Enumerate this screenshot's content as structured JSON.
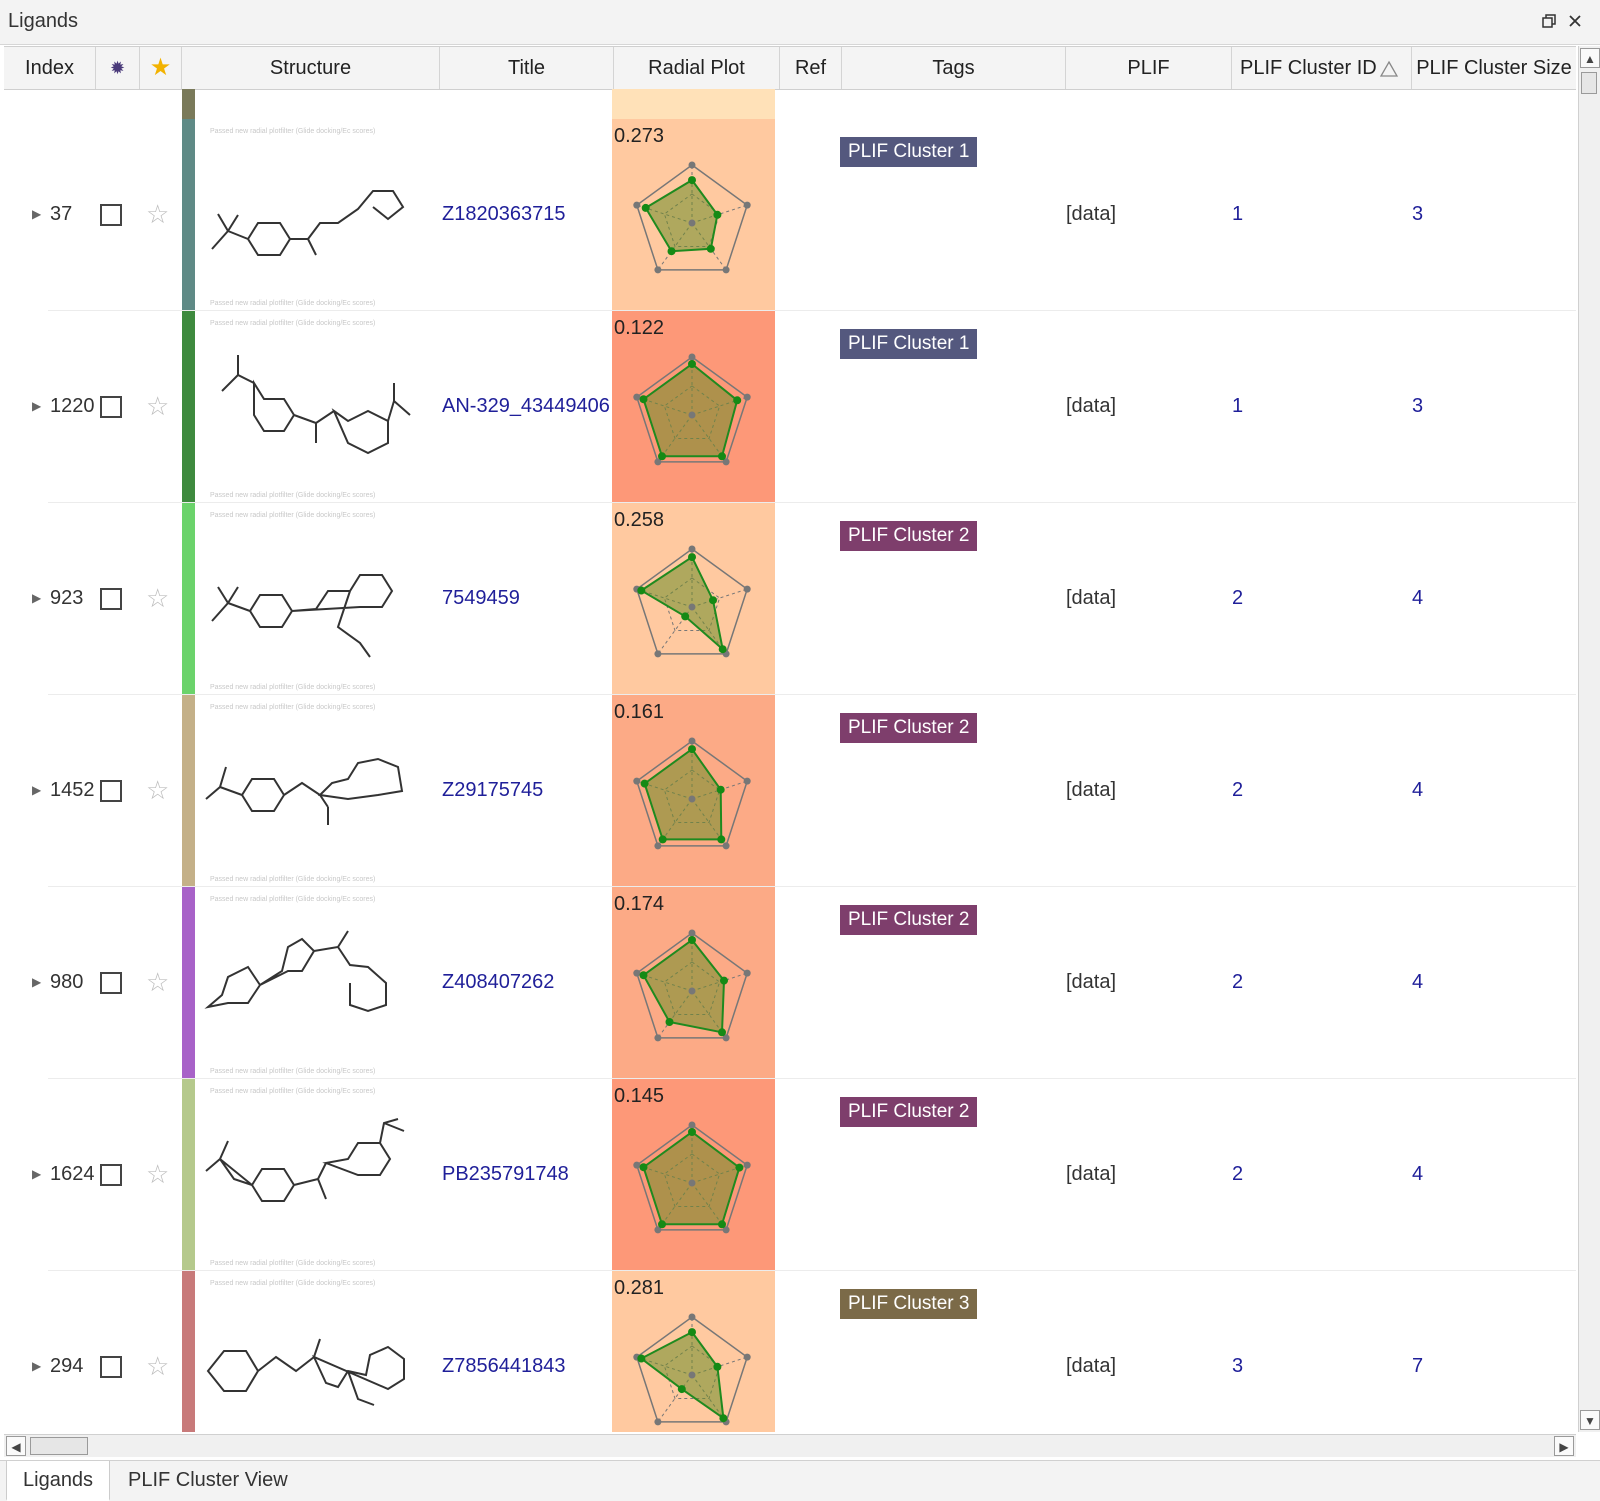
{
  "window": {
    "title": "Ligands",
    "restore_icon": "restore-icon",
    "close_icon": "close-icon"
  },
  "columns": {
    "index": "Index",
    "visibility_icon": "asterisk-icon",
    "favorite_icon": "star-icon",
    "structure": "Structure",
    "title": "Title",
    "radial_plot": "Radial Plot",
    "ref": "Ref",
    "tags": "Tags",
    "plif": "PLIF",
    "plif_cluster_id": "PLIF Cluster ID",
    "plif_cluster_size": "PLIF Cluster Size",
    "sort_indicator_icon": "sort-ascending-icon"
  },
  "structure_watermark": "Passed new radial plotfilter (Glide docking/Ec scores)",
  "rows": [
    {
      "index": "37",
      "title": "Z1820363715",
      "score": "0.273",
      "tag": "PLIF Cluster 1",
      "tag_color": "#54587e",
      "plif": "[data]",
      "cluster_id": "1",
      "cluster_size": "3",
      "bar_color": "#5f8a86",
      "radial_bg": "#ffc9a0",
      "radar": [
        0.74,
        0.46,
        0.55,
        0.6,
        0.84
      ]
    },
    {
      "index": "1220",
      "title": "AN-329_43449406",
      "score": "0.122",
      "tag": "PLIF Cluster 1",
      "tag_color": "#54587e",
      "plif": "[data]",
      "cluster_id": "1",
      "cluster_size": "3",
      "bar_color": "#3e8a3e",
      "radial_bg": "#fd9878",
      "radar": [
        0.88,
        0.82,
        0.88,
        0.88,
        0.88
      ]
    },
    {
      "index": "923",
      "title": "7549459",
      "score": "0.258",
      "tag": "PLIF Cluster 2",
      "tag_color": "#7e3e6c",
      "plif": "[data]",
      "cluster_id": "2",
      "cluster_size": "4",
      "bar_color": "#6bd36b",
      "radial_bg": "#ffc9a0",
      "radar": [
        0.86,
        0.38,
        0.9,
        0.2,
        0.92
      ]
    },
    {
      "index": "1452",
      "title": "Z29175745",
      "score": "0.161",
      "tag": "PLIF Cluster 2",
      "tag_color": "#7e3e6c",
      "plif": "[data]",
      "cluster_id": "2",
      "cluster_size": "4",
      "bar_color": "#c4b088",
      "radial_bg": "#fcaa86",
      "radar": [
        0.86,
        0.52,
        0.86,
        0.86,
        0.86
      ]
    },
    {
      "index": "980",
      "title": "Z408407262",
      "score": "0.174",
      "tag": "PLIF Cluster 2",
      "tag_color": "#7e3e6c",
      "plif": "[data]",
      "cluster_id": "2",
      "cluster_size": "4",
      "bar_color": "#a862c8",
      "radial_bg": "#fcaa86",
      "radar": [
        0.88,
        0.58,
        0.88,
        0.66,
        0.88
      ]
    },
    {
      "index": "1624",
      "title": "PB235791748",
      "score": "0.145",
      "tag": "PLIF Cluster 2",
      "tag_color": "#7e3e6c",
      "plif": "[data]",
      "cluster_id": "2",
      "cluster_size": "4",
      "bar_color": "#b5c98c",
      "radial_bg": "#fd9878",
      "radar": [
        0.88,
        0.86,
        0.88,
        0.88,
        0.88
      ]
    },
    {
      "index": "294",
      "title": "Z7856441843",
      "score": "0.281",
      "tag": "PLIF Cluster 3",
      "tag_color": "#7b6a48",
      "plif": "[data]",
      "cluster_id": "3",
      "cluster_size": "7",
      "bar_color": "#c87a7a",
      "radial_bg": "#ffc9a0",
      "radar": [
        0.74,
        0.46,
        0.92,
        0.3,
        0.92
      ]
    }
  ],
  "scrollbar": {
    "up_icon": "arrow-up-icon",
    "down_icon": "arrow-down-icon",
    "left_icon": "arrow-left-icon",
    "right_icon": "arrow-right-icon"
  },
  "tabs": [
    {
      "label": "Ligands",
      "active": true
    },
    {
      "label": "PLIF Cluster View",
      "active": false
    }
  ]
}
